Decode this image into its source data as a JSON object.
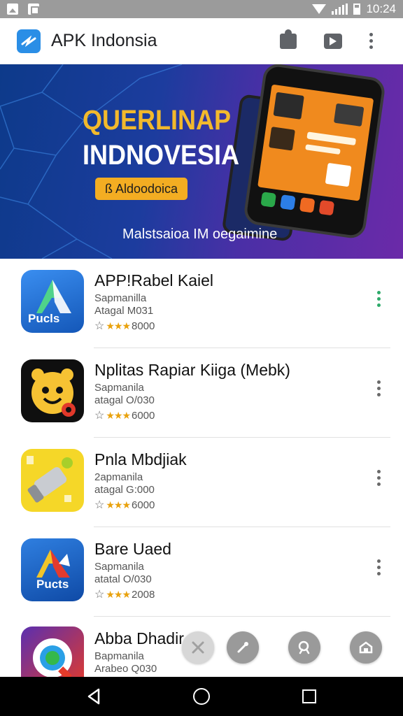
{
  "status_bar": {
    "time": "10:24",
    "left_icons": [
      "image-icon",
      "note-icon"
    ],
    "right_icons": [
      "wifi-icon",
      "signal-icon",
      "battery-icon"
    ]
  },
  "app_bar": {
    "title": "APK Indonsia",
    "actions": [
      "puzzle-icon",
      "play-box-icon",
      "more-vert-icon"
    ]
  },
  "banner": {
    "headline_1": "QUERLINAP",
    "headline_2": "INDNOVESIA",
    "cta": "ß Aldoodoica",
    "tagline": "Malstsaioa IM oegaimine"
  },
  "apps": [
    {
      "name": "APP!Rabel Kaiel",
      "developer": "Sapmanilla",
      "size": "Atagal M031",
      "rating": "8000",
      "menu_color": "#2eaa6a"
    },
    {
      "name": "Nplitas Rapiar Kiiga (Mebk)",
      "developer": "Sapmanila",
      "size": "atagal O/030",
      "rating": "6000",
      "menu_color": "#6a6a6a"
    },
    {
      "name": "Pnla Mbdjiak",
      "developer": "2apmanila",
      "size": "atagal G:000",
      "rating": "6000",
      "menu_color": "#6a6a6a"
    },
    {
      "name": "Bare Uaed",
      "developer": "Sapmanila",
      "size": "atatal O/030",
      "rating": "2008",
      "menu_color": "#6a6a6a"
    },
    {
      "name": "Abba Dhadir",
      "developer": "Bapmanila",
      "size": "Arabeo Q030",
      "rating": "",
      "menu_color": "#6a6a6a"
    }
  ],
  "icon_text": {
    "app1": "Pucls",
    "app4": "Pucts"
  },
  "floating_actions": [
    "close-icon",
    "edit-icon",
    "search-icon",
    "home-icon"
  ],
  "nav_bar": [
    "back-icon",
    "home-icon",
    "recents-icon"
  ],
  "colors": {
    "accent": "#2a8ee6",
    "star": "#e9a20d",
    "banner_yellow": "#f2b92c",
    "cta": "#f3ad22"
  }
}
